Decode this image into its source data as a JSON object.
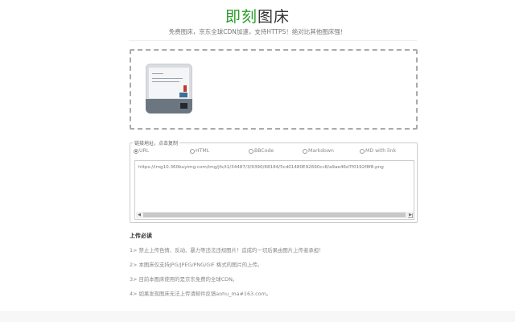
{
  "header": {
    "title_part1": "即刻",
    "title_part2": "图床",
    "subtitle": "免费图床，京东全球CDN加速，支持HTTPS！绝对比其他图床强！"
  },
  "upload": {
    "thumbnail_icon": "uploaded-image-thumbnail"
  },
  "links": {
    "legend": "链接地址，点击复制",
    "formats": [
      {
        "label": "URL",
        "checked": true
      },
      {
        "label": "HTML",
        "checked": false
      },
      {
        "label": "BBCode",
        "checked": false
      },
      {
        "label": "Markdown",
        "checked": false
      },
      {
        "label": "MD with link",
        "checked": false
      }
    ],
    "value": "https://img10.360buyimg.com/img/jfs/t1/34487/3/9390/68184/5cd01480E92690cc8/a9ae46d7f0192f8f8.png"
  },
  "notice": {
    "title": "上传必读",
    "items": [
      "1> 禁止上传色情、反动、暴力等违法违规图片！造成的一切后果由图片上传者承担！",
      "2> 本图床仅支持JPG/JPEG/PNG/GIF 格式的图片的上传。",
      "3> 目前本图床使用的是京东免费的全球CDN。",
      "4> 如果发现图床无法上传请邮件反馈aohu_ma#163.com。"
    ]
  }
}
